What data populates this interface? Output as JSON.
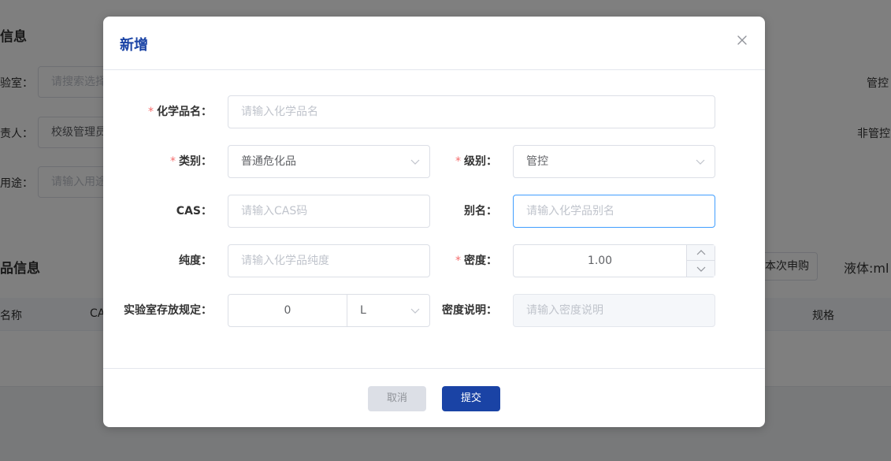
{
  "background": {
    "section1_title": "信息",
    "lab_label": "验室：",
    "lab_placeholder": "请搜索选择",
    "control_label_right": "管控",
    "owner_label": "责人：",
    "owner_value": "校级管理员",
    "noncontrol_label_right": "非管控",
    "purpose_label": "用途：",
    "purpose_placeholder": "请输入用途",
    "section2_title": "品信息",
    "apply_chip": "本次申购",
    "liquid_chip": "液体:ml",
    "col_name": "名称",
    "col_cas": "CA",
    "col_spec": "规格"
  },
  "dialog": {
    "title": "新增",
    "close_icon": "close-icon",
    "fields": {
      "name": {
        "label": "化学品名：",
        "required": "*",
        "placeholder": "请输入化学品名"
      },
      "category": {
        "label": "类别：",
        "required": "*",
        "value": "普通危化品"
      },
      "level": {
        "label": "级别：",
        "required": "*",
        "value": "管控"
      },
      "cas": {
        "label": "CAS：",
        "placeholder": "请输入CAS码"
      },
      "alias": {
        "label": "别名：",
        "placeholder": "请输入化学品别名"
      },
      "purity": {
        "label": "纯度：",
        "placeholder": "请输入化学品纯度"
      },
      "density": {
        "label": "密度：",
        "required": "*",
        "value": "1.00"
      },
      "storage": {
        "label": "实验室存放规定：",
        "value": "0",
        "unit": "L"
      },
      "density_note": {
        "label": "密度说明：",
        "placeholder": "请输入密度说明"
      }
    },
    "buttons": {
      "cancel": "取消",
      "submit": "提交"
    }
  }
}
